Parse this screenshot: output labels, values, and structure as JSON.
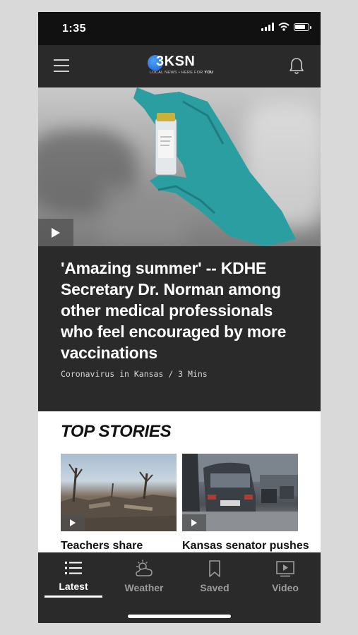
{
  "status_bar": {
    "time": "1:35",
    "battery_level": 0.85
  },
  "header": {
    "logo_text": "3KSN",
    "logo_tagline_prefix": "LOCAL NEWS • HERE FOR ",
    "logo_tagline_emph": "YOU",
    "menu_icon": "hamburger-menu-icon",
    "notifications_icon": "bell-icon"
  },
  "hero": {
    "headline": "'Amazing summer' -- KDHE Secretary Dr. Norman among other medical professionals who feel encouraged by more vaccinations",
    "meta": "Coronavirus in Kansas / 3 Mins",
    "play_icon": "play-icon"
  },
  "top_stories": {
    "title": "TOP STORIES",
    "items": [
      {
        "title": "Teachers share"
      },
      {
        "title": "Kansas senator pushes"
      }
    ]
  },
  "tab_bar": {
    "tabs": [
      {
        "label": "Latest",
        "icon": "list-icon",
        "active": true
      },
      {
        "label": "Weather",
        "icon": "partly-cloudy-icon",
        "active": false
      },
      {
        "label": "Saved",
        "icon": "bookmark-icon",
        "active": false
      },
      {
        "label": "Video",
        "icon": "video-play-icon",
        "active": false
      }
    ]
  }
}
